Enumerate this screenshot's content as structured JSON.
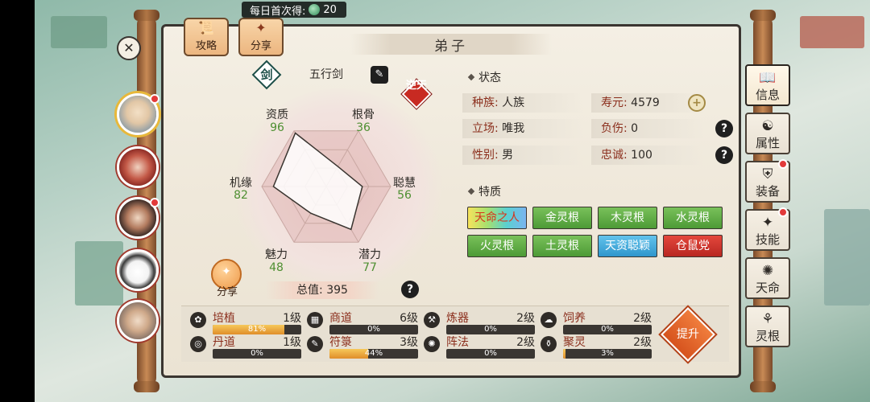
{
  "daily_banner": {
    "label": "每日首次得:",
    "amount": "20"
  },
  "top_buttons": {
    "guide": "攻略",
    "share": "分享"
  },
  "panel_title": "弟子",
  "weapon": {
    "badge_char": "剑",
    "name": "五行剑",
    "tag": "逆天"
  },
  "stats": {
    "zizhi": {
      "label": "资质",
      "value": 96
    },
    "gengu": {
      "label": "根骨",
      "value": 36
    },
    "conghui": {
      "label": "聪慧",
      "value": 56
    },
    "qianli": {
      "label": "潜力",
      "value": 77
    },
    "meili": {
      "label": "魅力",
      "value": 48
    },
    "jiyuan": {
      "label": "机缘",
      "value": 82
    }
  },
  "total": {
    "text": "总值: 395"
  },
  "share_circle_label": "分享",
  "status": {
    "title": "状态",
    "race": {
      "label": "种族:",
      "value": "人族"
    },
    "lifespan": {
      "label": "寿元:",
      "value": "4579"
    },
    "stance": {
      "label": "立场:",
      "value": "唯我"
    },
    "injury": {
      "label": "负伤:",
      "value": "0"
    },
    "gender": {
      "label": "性别:",
      "value": "男"
    },
    "loyalty": {
      "label": "忠诚:",
      "value": "100"
    }
  },
  "traits": {
    "title": "特质",
    "items": [
      {
        "label": "天命之人",
        "color": "rainbow"
      },
      {
        "label": "金灵根",
        "color": "green"
      },
      {
        "label": "木灵根",
        "color": "green"
      },
      {
        "label": "水灵根",
        "color": "green"
      },
      {
        "label": "火灵根",
        "color": "green"
      },
      {
        "label": "土灵根",
        "color": "green"
      },
      {
        "label": "天资聪颖",
        "color": "blue"
      },
      {
        "label": "仓鼠党",
        "color": "red"
      }
    ]
  },
  "skills": [
    {
      "name": "培植",
      "level": "1级",
      "percent": 81,
      "percent_text": "81%"
    },
    {
      "name": "商道",
      "level": "6级",
      "percent": 0,
      "percent_text": "0%"
    },
    {
      "name": "炼器",
      "level": "2级",
      "percent": 0,
      "percent_text": "0%"
    },
    {
      "name": "饲养",
      "level": "2级",
      "percent": 0,
      "percent_text": "0%"
    },
    {
      "name": "丹道",
      "level": "1级",
      "percent": 0,
      "percent_text": "0%"
    },
    {
      "name": "符箓",
      "level": "3级",
      "percent": 44,
      "percent_text": "44%"
    },
    {
      "name": "阵法",
      "level": "2级",
      "percent": 0,
      "percent_text": "0%"
    },
    {
      "name": "聚灵",
      "level": "2级",
      "percent": 3,
      "percent_text": "3%"
    }
  ],
  "upgrade_button": "提升",
  "right_tabs": [
    {
      "label": "信息",
      "icon": "book-icon"
    },
    {
      "label": "属性",
      "icon": "figure-icon"
    },
    {
      "label": "装备",
      "icon": "armor-icon"
    },
    {
      "label": "技能",
      "icon": "scroll-icon"
    },
    {
      "label": "天命",
      "icon": "fate-icon"
    },
    {
      "label": "灵根",
      "icon": "root-icon"
    }
  ]
}
